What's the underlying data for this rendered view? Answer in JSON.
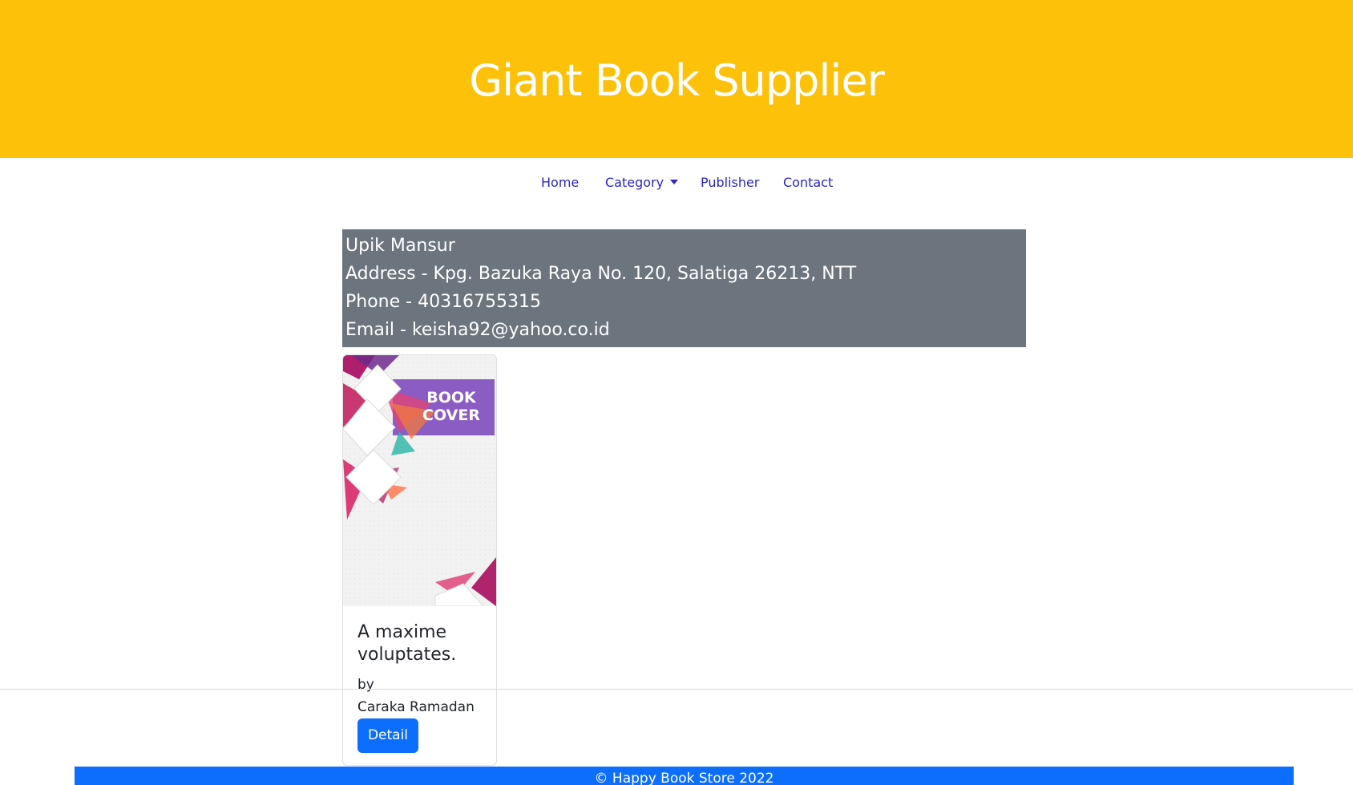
{
  "header": {
    "title": "Giant Book Supplier",
    "background_color": "#fdc10a"
  },
  "nav": {
    "home": "Home",
    "category": "Category",
    "publisher": "Publisher",
    "contact": "Contact",
    "link_color": "#2a25c7"
  },
  "publisher_info": {
    "name": "Upik Mansur",
    "address": "Address - Kpg. Bazuka Raya No. 120, Salatiga 26213, NTT",
    "phone": "Phone - 40316755315",
    "email": "Email - keisha92@yahoo.co.id",
    "background_color": "#6c757d"
  },
  "books": [
    {
      "cover_text_line1": "BOOK",
      "cover_text_line2": "COVER",
      "title": "A maxime voluptates.",
      "by_label": "by",
      "author": "Caraka Ramadan",
      "detail_button": "Detail"
    }
  ],
  "footer": {
    "text": "© Happy Book Store 2022",
    "background_color": "#0d6efd"
  }
}
